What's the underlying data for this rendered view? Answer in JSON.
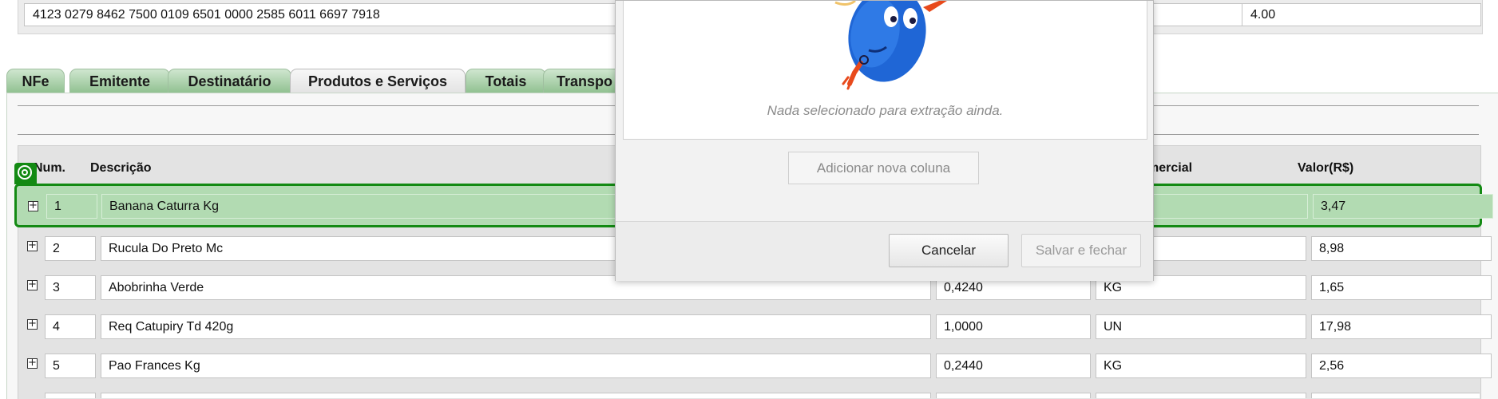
{
  "header": {
    "chave_acesso": "4123 0279 8462 7500 0109 6501 0000 2585 6011 6697 7918",
    "versao": "4.00"
  },
  "tabs": [
    {
      "label": "NFe"
    },
    {
      "label": "Emitente"
    },
    {
      "label": "Destinatário"
    },
    {
      "label": "Produtos e Serviços",
      "active": true
    },
    {
      "label": "Totais"
    },
    {
      "label": "Transpo"
    }
  ],
  "table": {
    "headers": {
      "num": "Num.",
      "descricao": "Descrição",
      "unidade": "mercial",
      "valor": "Valor(R$)"
    },
    "rows": [
      {
        "num": "1",
        "descricao": "Banana Caturra Kg",
        "quantidade": "",
        "unidade": "",
        "valor": "3,47"
      },
      {
        "num": "2",
        "descricao": "Rucula Do Preto Mc",
        "quantidade": "",
        "unidade": "",
        "valor": "8,98"
      },
      {
        "num": "3",
        "descricao": "Abobrinha Verde",
        "quantidade": "0,4240",
        "unidade": "KG",
        "valor": "1,65"
      },
      {
        "num": "4",
        "descricao": "Req Catupiry Td 420g",
        "quantidade": "1,0000",
        "unidade": "UN",
        "valor": "17,98"
      },
      {
        "num": "5",
        "descricao": "Pao Frances Kg",
        "quantidade": "0,2440",
        "unidade": "KG",
        "valor": "2,56"
      }
    ]
  },
  "dialog": {
    "empty_message": "Nada selecionado para extração ainda.",
    "add_column_label": "Adicionar nova coluna",
    "cancel_label": "Cancelar",
    "save_label": "Salvar e fechar"
  },
  "colors": {
    "tab_green": "#8fc08f",
    "selection_green": "#138a13",
    "selection_fill": "#b2dbb2"
  }
}
